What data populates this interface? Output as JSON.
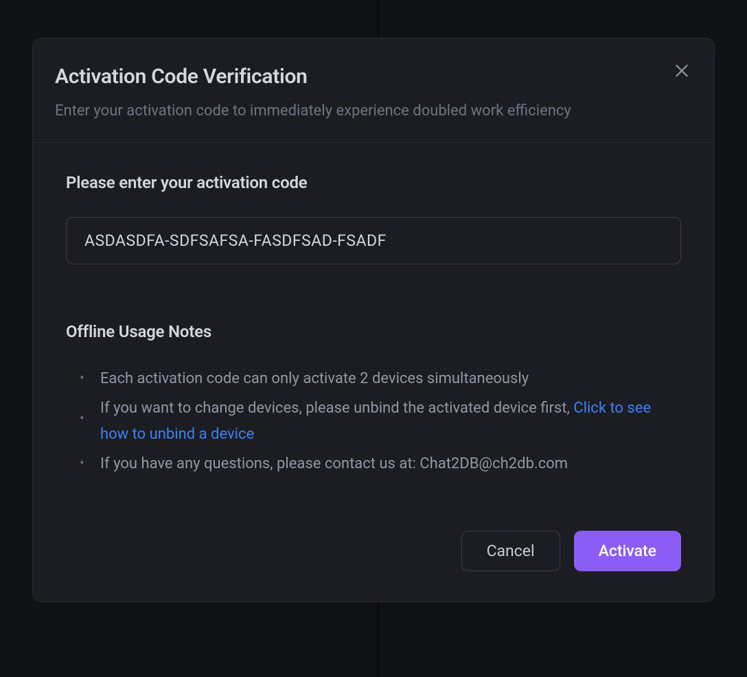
{
  "modal": {
    "title": "Activation Code Verification",
    "subtitle": "Enter your activation code to immediately experience doubled work efficiency",
    "section_title": "Please enter your activation code",
    "code_value": "ASDASDFA-SDFSAFSA-FASDFSAD-FSADF",
    "notes": {
      "title": "Offline Usage Notes",
      "item1": "Each activation code can only activate 2 devices simultaneously",
      "item2_prefix": "If you want to change devices, please unbind the activated device first, ",
      "item2_link": "Click to see how to unbind a device",
      "item3": "If you have any questions, please contact us at: Chat2DB@ch2db.com"
    },
    "buttons": {
      "cancel": "Cancel",
      "activate": "Activate"
    }
  }
}
